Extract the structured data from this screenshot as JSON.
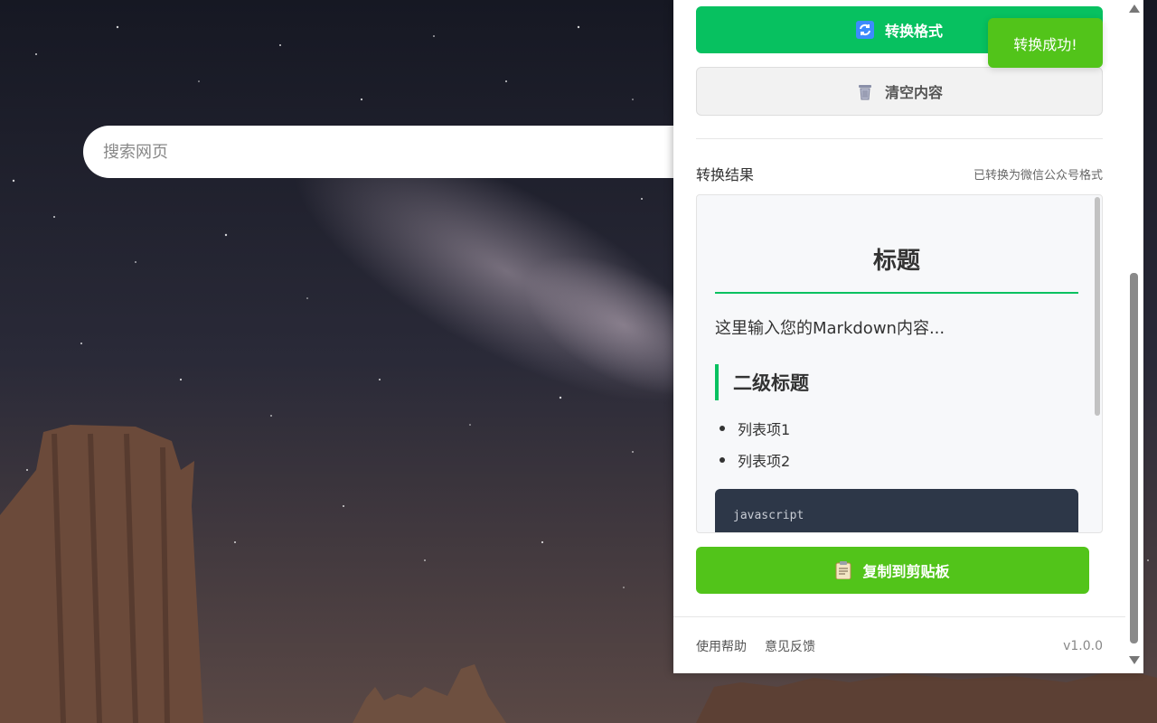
{
  "search": {
    "placeholder": "搜索网页"
  },
  "panel": {
    "convert_button": "转换格式",
    "clear_button": "清空内容",
    "result_label": "转换结果",
    "result_status": "已转换为微信公众号格式",
    "preview": {
      "title": "标题",
      "paragraph": "这里输入您的Markdown内容...",
      "heading2": "二级标题",
      "list_items": [
        "列表项1",
        "列表项2"
      ],
      "code_lang": "javascript"
    },
    "copy_button": "复制到剪贴板",
    "footer": {
      "help": "使用帮助",
      "feedback": "意见反馈",
      "version": "v1.0.0"
    }
  },
  "toast": {
    "text": "转换成功!"
  },
  "colors": {
    "primary_green": "#07c160",
    "success_green": "#52c41a",
    "code_bg": "#2d3748"
  },
  "icons": {
    "convert": "refresh-icon",
    "clear": "trash-icon",
    "copy": "clipboard-icon"
  }
}
